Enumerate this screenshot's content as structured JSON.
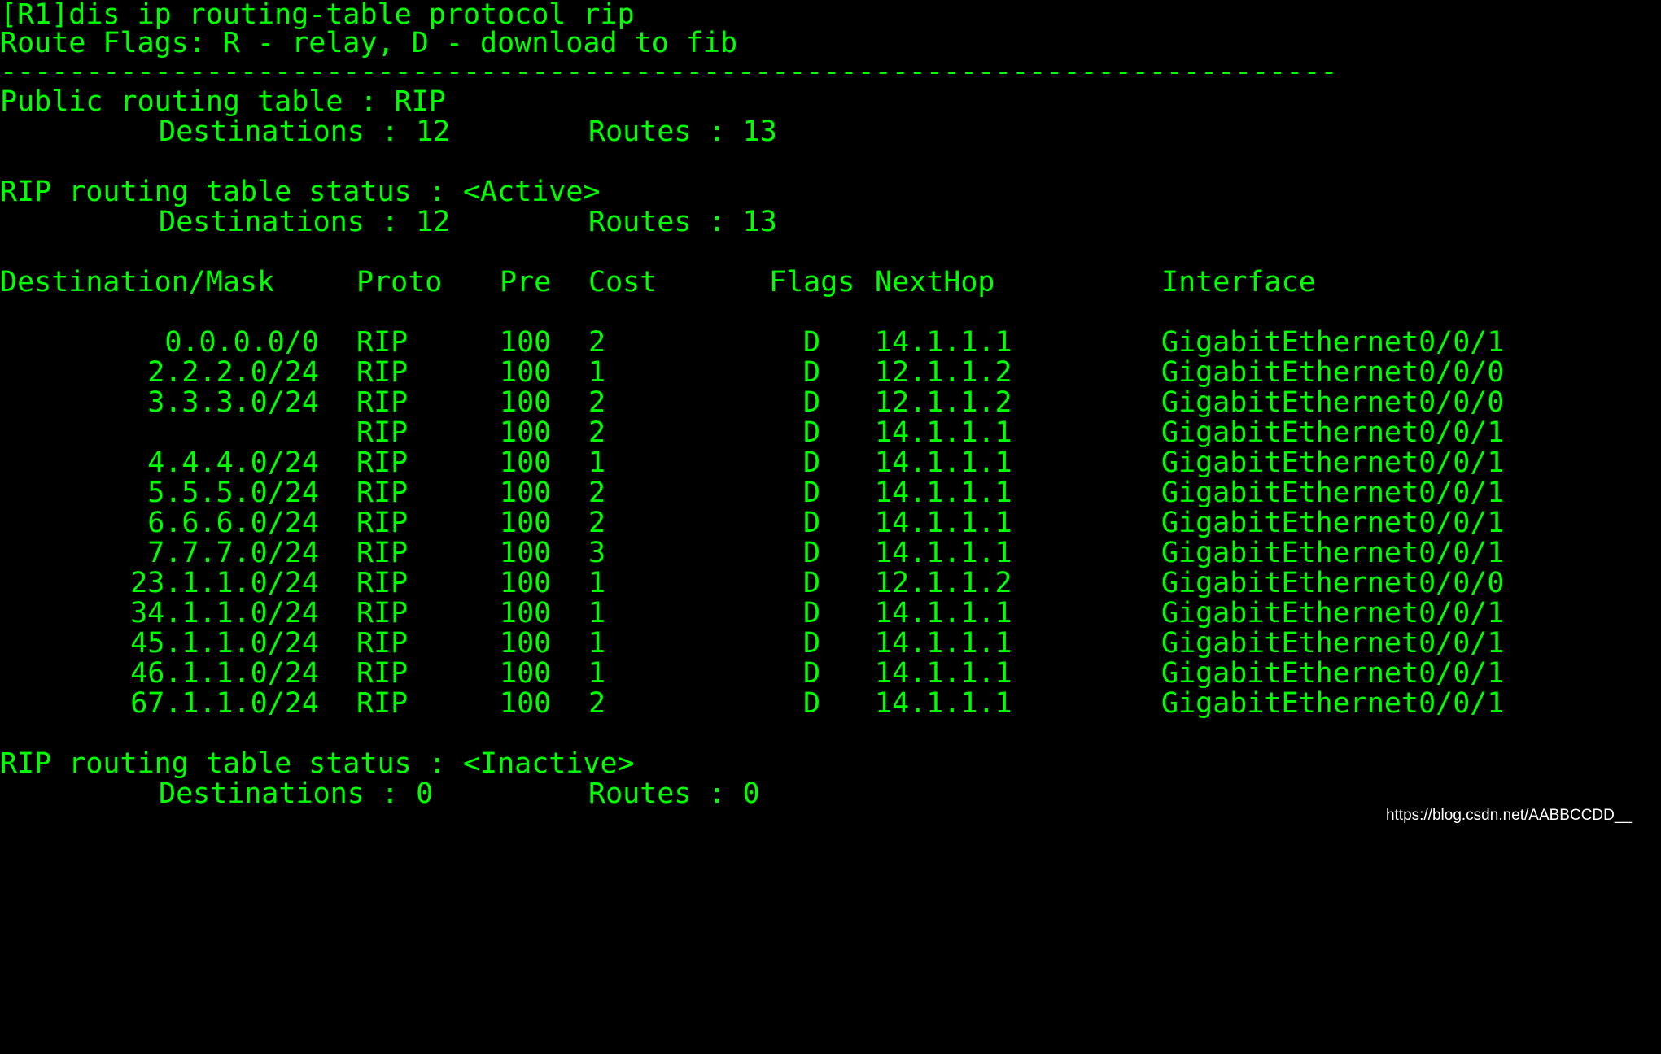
{
  "terminal": {
    "command_line": "[R1]dis ip routing-table protocol rip",
    "flags_line": "Route Flags: R - relay, D - download to fib",
    "separator": "------------------------------------------------------------------------------",
    "public_title": "Public routing table : RIP",
    "public_destinations": "Destinations : 12",
    "public_routes": "Routes : 13",
    "active_title": "RIP routing table status : <Active>",
    "active_destinations": "Destinations : 12",
    "active_routes": "Routes : 13",
    "columns": {
      "destination": "Destination/Mask",
      "proto": "Proto",
      "pre": "Pre",
      "cost": "Cost",
      "flags": "Flags",
      "nexthop": "NextHop",
      "interface": "Interface"
    },
    "rows": [
      {
        "dest": "0.0.0.0/0",
        "proto": "RIP",
        "pre": "100",
        "cost": "2",
        "flags": "D",
        "nexthop": "14.1.1.1",
        "iface": "GigabitEthernet0/0/1"
      },
      {
        "dest": "2.2.2.0/24",
        "proto": "RIP",
        "pre": "100",
        "cost": "1",
        "flags": "D",
        "nexthop": "12.1.1.2",
        "iface": "GigabitEthernet0/0/0"
      },
      {
        "dest": "3.3.3.0/24",
        "proto": "RIP",
        "pre": "100",
        "cost": "2",
        "flags": "D",
        "nexthop": "12.1.1.2",
        "iface": "GigabitEthernet0/0/0"
      },
      {
        "dest": "",
        "proto": "RIP",
        "pre": "100",
        "cost": "2",
        "flags": "D",
        "nexthop": "14.1.1.1",
        "iface": "GigabitEthernet0/0/1"
      },
      {
        "dest": "4.4.4.0/24",
        "proto": "RIP",
        "pre": "100",
        "cost": "1",
        "flags": "D",
        "nexthop": "14.1.1.1",
        "iface": "GigabitEthernet0/0/1"
      },
      {
        "dest": "5.5.5.0/24",
        "proto": "RIP",
        "pre": "100",
        "cost": "2",
        "flags": "D",
        "nexthop": "14.1.1.1",
        "iface": "GigabitEthernet0/0/1"
      },
      {
        "dest": "6.6.6.0/24",
        "proto": "RIP",
        "pre": "100",
        "cost": "2",
        "flags": "D",
        "nexthop": "14.1.1.1",
        "iface": "GigabitEthernet0/0/1"
      },
      {
        "dest": "7.7.7.0/24",
        "proto": "RIP",
        "pre": "100",
        "cost": "3",
        "flags": "D",
        "nexthop": "14.1.1.1",
        "iface": "GigabitEthernet0/0/1"
      },
      {
        "dest": "23.1.1.0/24",
        "proto": "RIP",
        "pre": "100",
        "cost": "1",
        "flags": "D",
        "nexthop": "12.1.1.2",
        "iface": "GigabitEthernet0/0/0"
      },
      {
        "dest": "34.1.1.0/24",
        "proto": "RIP",
        "pre": "100",
        "cost": "1",
        "flags": "D",
        "nexthop": "14.1.1.1",
        "iface": "GigabitEthernet0/0/1"
      },
      {
        "dest": "45.1.1.0/24",
        "proto": "RIP",
        "pre": "100",
        "cost": "1",
        "flags": "D",
        "nexthop": "14.1.1.1",
        "iface": "GigabitEthernet0/0/1"
      },
      {
        "dest": "46.1.1.0/24",
        "proto": "RIP",
        "pre": "100",
        "cost": "1",
        "flags": "D",
        "nexthop": "14.1.1.1",
        "iface": "GigabitEthernet0/0/1"
      },
      {
        "dest": "67.1.1.0/24",
        "proto": "RIP",
        "pre": "100",
        "cost": "2",
        "flags": "D",
        "nexthop": "14.1.1.1",
        "iface": "GigabitEthernet0/0/1"
      }
    ],
    "inactive_title": "RIP routing table status : <Inactive>",
    "inactive_destinations": "Destinations : 0",
    "inactive_routes": "Routes : 0"
  },
  "watermark": "https://blog.csdn.net/AABBCCDD__",
  "colors": {
    "background": "#000000",
    "text": "#00ff00",
    "watermark": "#ffffff"
  }
}
